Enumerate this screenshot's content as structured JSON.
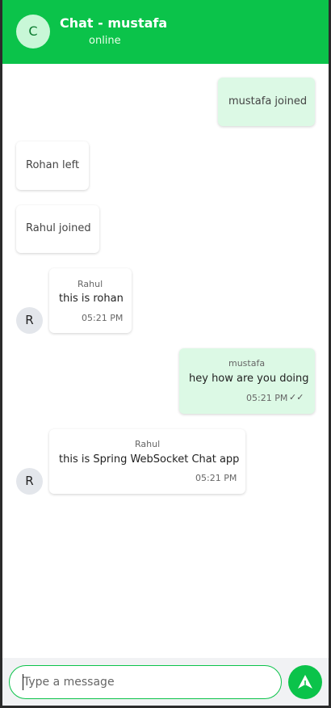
{
  "header": {
    "avatar_letter": "C",
    "title": "Chat - mustafa",
    "status": "online"
  },
  "messages": [
    {
      "type": "event",
      "side": "right",
      "text": "mustafa joined"
    },
    {
      "type": "event",
      "side": "left",
      "text": "Rohan left"
    },
    {
      "type": "event",
      "side": "left",
      "text": "Rahul joined"
    },
    {
      "type": "message",
      "side": "left",
      "avatar": "R",
      "sender": "Rahul",
      "text": "this is rohan",
      "time": "05:21 PM"
    },
    {
      "type": "message",
      "side": "right",
      "sender": "mustafa",
      "text": "hey how are you doing",
      "time": "05:21 PM",
      "ticks": "✓✓"
    },
    {
      "type": "message",
      "side": "left",
      "avatar": "R",
      "sender": "Rahul",
      "text": "this is Spring WebSocket Chat app",
      "time": "05:21 PM"
    }
  ],
  "composer": {
    "placeholder": "Type a message",
    "send_icon": "send-arrow-icon"
  },
  "colors": {
    "accent": "#0bc34a",
    "mine_bubble": "#dcf9e5"
  }
}
